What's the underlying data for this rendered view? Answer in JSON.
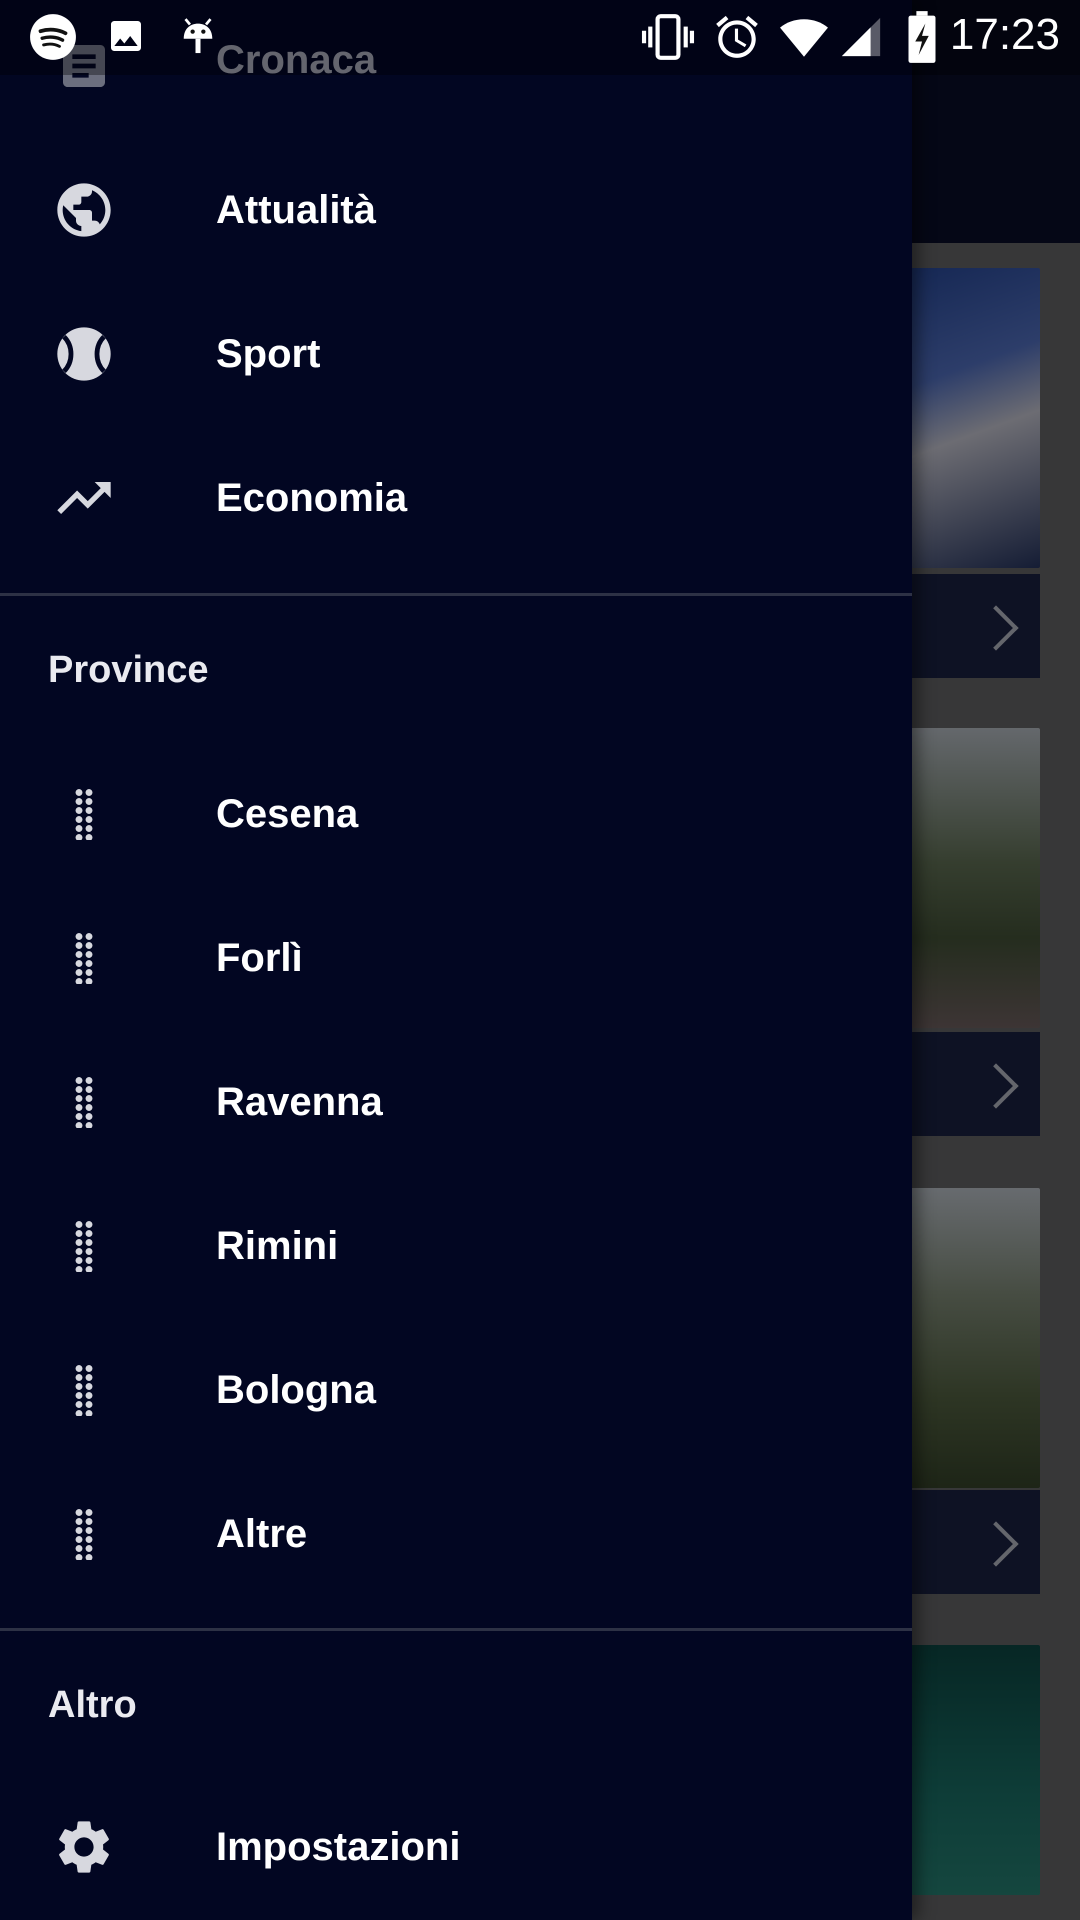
{
  "status_bar": {
    "time": "17:23",
    "left_icons": [
      "spotify-icon",
      "image-icon",
      "android-debug-icon"
    ],
    "right_icons": [
      "vibrate-icon",
      "alarm-icon",
      "wifi-icon",
      "cell-signal-icon",
      "battery-charging-icon"
    ]
  },
  "drawer": {
    "top_items": [
      {
        "label": "Cronaca",
        "icon": "article-icon"
      },
      {
        "label": "Attualità",
        "icon": "globe-icon"
      },
      {
        "label": "Sport",
        "icon": "tennis-ball-icon"
      },
      {
        "label": "Economia",
        "icon": "trending-up-icon"
      }
    ],
    "province": {
      "title": "Province",
      "items": [
        {
          "label": "Cesena",
          "icon": "drag-handle-icon"
        },
        {
          "label": "Forlì",
          "icon": "drag-handle-icon"
        },
        {
          "label": "Ravenna",
          "icon": "drag-handle-icon"
        },
        {
          "label": "Rimini",
          "icon": "drag-handle-icon"
        },
        {
          "label": "Bologna",
          "icon": "drag-handle-icon"
        },
        {
          "label": "Altre",
          "icon": "drag-handle-icon"
        }
      ]
    },
    "altro": {
      "title": "Altro",
      "items": [
        {
          "label": "Impostazioni",
          "icon": "gear-icon"
        }
      ]
    }
  },
  "colors": {
    "drawer_bg": "#020622",
    "toolbar_bg": "#0b0f2d",
    "text": "#ffffff",
    "icon": "#d7d8df",
    "divider": "#2d3145"
  }
}
